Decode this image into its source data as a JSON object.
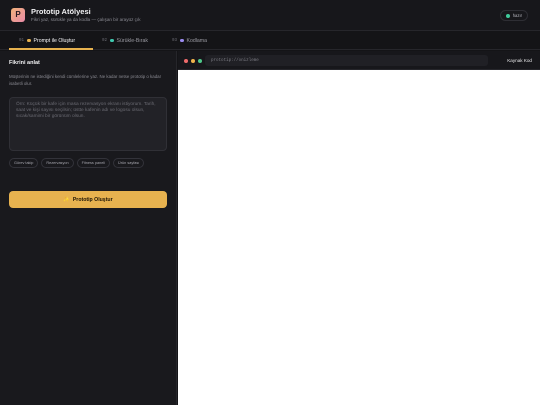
{
  "header": {
    "logo_letter": "P",
    "title": "Prototip Atölyesi",
    "subtitle": "Fikri yaz, sürükle ya da kodla — çalışan bir arayüz çık",
    "status": "hazır"
  },
  "tabs": [
    {
      "num": "01",
      "label": "Prompt ile Oluştur",
      "dot_color": "#e7b24f"
    },
    {
      "num": "02",
      "label": "Sürükle-Bırak",
      "dot_color": "#3fc9b0"
    },
    {
      "num": "03",
      "label": "Kodlama",
      "dot_color": "#9b8cf0"
    }
  ],
  "left_panel": {
    "title": "Fikrini anlat",
    "description": "Müşterinin ne istediğini kendi cümlelerine yaz. Ne kadar netse prototip o kadar isabetli olur.",
    "prompt_placeholder": "Örn: Küçük bir kafe için masa rezervasyon ekranı istiyorum. Tarih, saat ve kişi sayısı seçilsin; üstte kafenin adı ve logosu olsun, sıcak/samimi bir görünüm olsun.",
    "prompt_value": "",
    "chips": [
      "Görev takip",
      "Rezervasyon",
      "Fitness paneli",
      "Ürün sayfası"
    ],
    "generate_button": {
      "icon": "✨",
      "label": "Prototip Oluştur"
    }
  },
  "preview": {
    "traffic_colors": [
      "#ef6b6b",
      "#f0b44c",
      "#4fc98a"
    ],
    "url": "prototip://onizleme",
    "source_button": "Kaynak Kod"
  }
}
